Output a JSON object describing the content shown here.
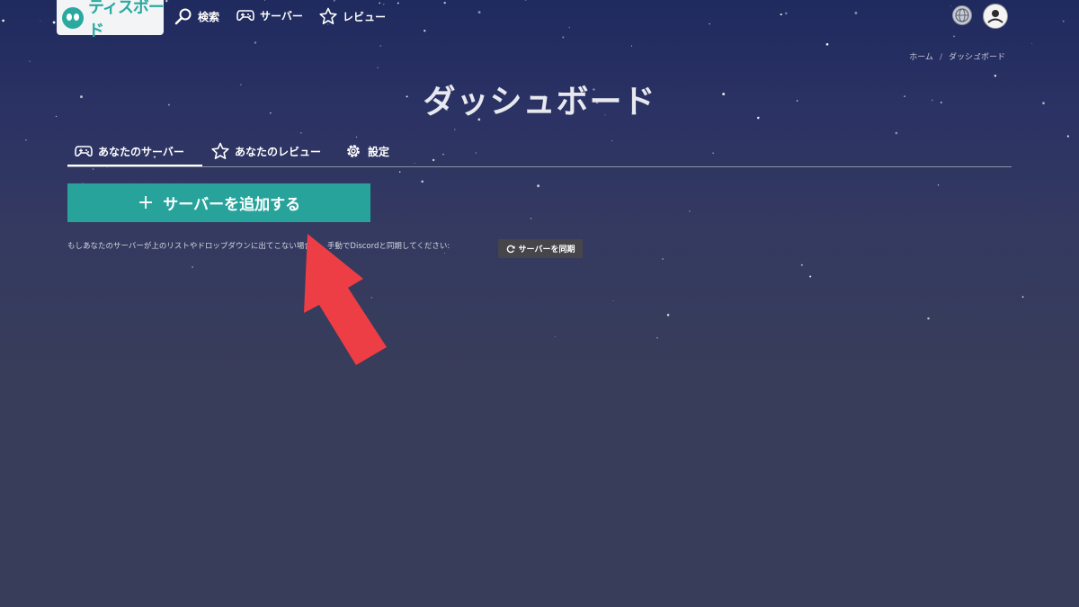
{
  "brand": {
    "name": "ティスボード"
  },
  "nav": {
    "search": "検索",
    "servers": "サーバー",
    "reviews": "レビュー"
  },
  "breadcrumb": {
    "home": "ホーム",
    "separator": "/",
    "current": "ダッシュボード"
  },
  "page": {
    "title": "ダッシュボード"
  },
  "tabs": [
    {
      "label": "あなたのサーバー",
      "icon": "gamepad-icon",
      "active": true
    },
    {
      "label": "あなたのレビュー",
      "icon": "star-icon",
      "active": false
    },
    {
      "label": "設定",
      "icon": "gear-icon",
      "active": false
    }
  ],
  "actions": {
    "add_server": "サーバーを追加する",
    "add_icon": "+",
    "hint": "もしあなたのサーバーが上のリストやドロップダウンに出てこない場合は、手動でDiscordと同期してください:",
    "sync_servers": "サーバーを同期"
  },
  "colors": {
    "accent": "#27a39c",
    "annotation_arrow": "#ee3e45",
    "sync_button": "#46464a"
  }
}
